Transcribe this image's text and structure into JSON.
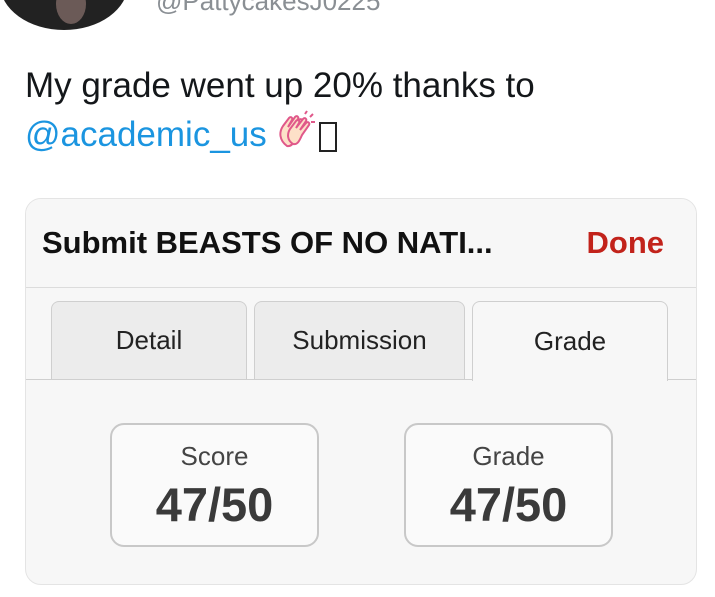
{
  "header": {
    "handle": "@PattycakesJ0225"
  },
  "tweet": {
    "text_line1": "My grade went up 20% thanks to",
    "mention": "@academic_us"
  },
  "card": {
    "title": "Submit BEASTS OF NO NATI...",
    "done_label": "Done",
    "tabs": [
      {
        "label": "Detail"
      },
      {
        "label": "Submission"
      },
      {
        "label": "Grade"
      }
    ],
    "score": {
      "label": "Score",
      "value": "47/50"
    },
    "grade": {
      "label": "Grade",
      "value": "47/50"
    }
  },
  "colors": {
    "mention": "#1b95e0",
    "done": "#c2231b"
  },
  "icons": [
    "clapping-hands-icon",
    "missing-glyph-icon"
  ]
}
